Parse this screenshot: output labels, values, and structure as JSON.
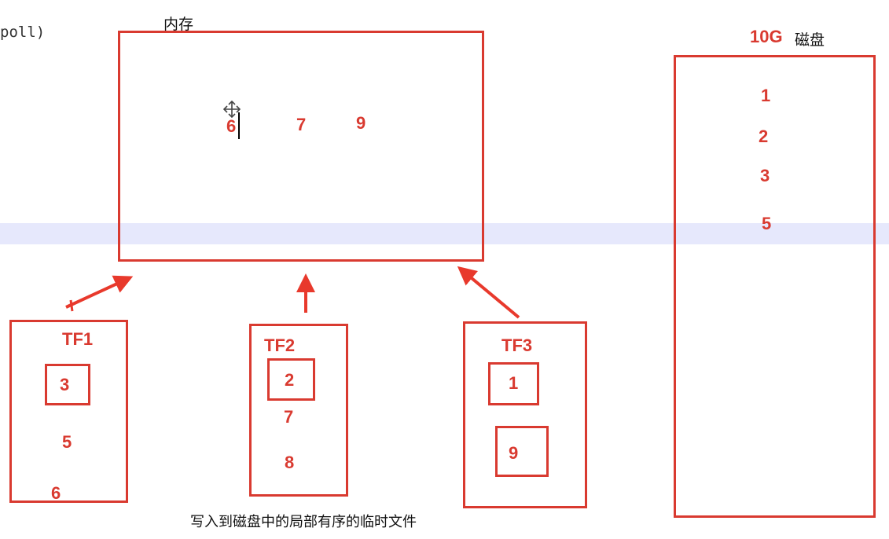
{
  "code_fragment": "poll)",
  "memory": {
    "label": "内存",
    "values": [
      "6",
      "7",
      "9"
    ]
  },
  "disk": {
    "size": "10G",
    "label": "磁盘",
    "values": [
      "1",
      "2",
      "3",
      "5"
    ]
  },
  "tf1": {
    "label": "TF1",
    "boxed": "3",
    "values": [
      "5",
      "6"
    ]
  },
  "tf2": {
    "label": "TF2",
    "boxed": "2",
    "values": [
      "7",
      "8"
    ]
  },
  "tf3": {
    "label": "TF3",
    "boxed": [
      "1",
      "9"
    ]
  },
  "caption": "写入到磁盘中的局部有序的临时文件",
  "colors": {
    "accent": "#d93a30",
    "highlight_band": "#e6e8fc"
  },
  "icons": [
    "move-cursor-icon",
    "text-cursor"
  ]
}
